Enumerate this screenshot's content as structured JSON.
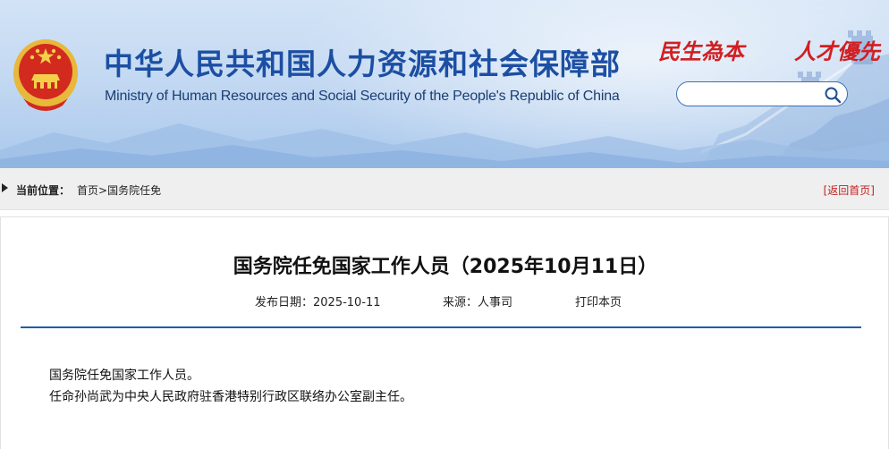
{
  "header": {
    "title_cn": "中华人民共和国人力资源和社会保障部",
    "title_en": "Ministry of Human Resources and Social Security of the People's Republic of China",
    "slogan_left": "民生為本",
    "slogan_right": "人才優先",
    "search": {
      "value": "",
      "placeholder": ""
    },
    "icons": {
      "emblem": "national-emblem-icon",
      "search": "search-icon"
    }
  },
  "breadcrumb": {
    "label": "当前位置：",
    "items": [
      "首页",
      "国务院任免"
    ],
    "separator": ">",
    "back_home": "[返回首页]"
  },
  "article": {
    "title": "国务院任免国家工作人员（2025年10月11日）",
    "date": "发布日期：2025-10-11",
    "source": "来源：人事司",
    "print": "打印本页",
    "paragraphs": [
      "国务院任免国家工作人员。",
      "任命孙尚武为中央人民政府驻香港特别行政区联络办公室副主任。"
    ]
  },
  "colors": {
    "title_blue": "#1c4fa3",
    "slogan_red": "#d11f22",
    "divider_blue": "#1f5ea8",
    "back_link_red": "#c32121"
  }
}
